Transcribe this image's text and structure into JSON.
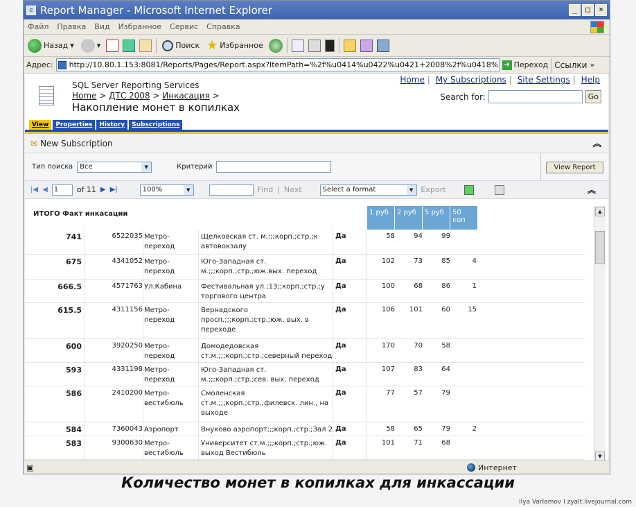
{
  "window": {
    "title": "Report Manager - Microsoft Internet Explorer"
  },
  "menu": [
    "Файл",
    "Правка",
    "Вид",
    "Избранное",
    "Сервис",
    "Справка"
  ],
  "toolbar": {
    "back": "Назад",
    "search": "Поиск",
    "favorites": "Избранное"
  },
  "address": {
    "label": "Адрес:",
    "url": "http://10.80.1.153:8081/Reports/Pages/Report.aspx?ItemPath=%2f%u0414%u0422%u0421+2008%2f%u0418%u043d%u",
    "go": "Переход",
    "links": "Ссылки"
  },
  "report_header": {
    "service": "SQL Server Reporting Services",
    "breadcrumb": [
      "Home",
      "ДТС 2008",
      "Инкасация"
    ],
    "title": "Накопление монет в копилках",
    "links": [
      "Home",
      "My Subscriptions",
      "Site Settings",
      "Help"
    ],
    "search_label": "Search for:",
    "go": "Go"
  },
  "tabs": [
    "View",
    "Properties",
    "History",
    "Subscriptions"
  ],
  "new_subscription": "New Subscription",
  "params": {
    "search_type_label": "Тип поиска",
    "search_type_value": "Все",
    "criteria_label": "Критерий",
    "view_report": "View Report"
  },
  "report_toolbar": {
    "page": "1",
    "of_pages": "of 11",
    "zoom": "100%",
    "find": "Find",
    "next": "Next",
    "format": "Select a format",
    "export": "Export"
  },
  "report": {
    "title": "ИТОГО Факт инкасации",
    "columns": [
      "1 руб",
      "2 руб",
      "5 руб",
      "50 коп"
    ],
    "rows": [
      {
        "total": "741",
        "id": "6522035",
        "type": "Метро-\nпереход",
        "address": "Щелковская ст. м.;;;корп.;стр.;к автовокзалу",
        "flag": "Да",
        "r1": "58",
        "r2": "94",
        "r5": "99",
        "k50": ""
      },
      {
        "total": "675",
        "id": "4341052",
        "type": "Метро-\nпереход",
        "address": "Юго-Западная ст. м.;;;корп.;стр.;юж.вых. переход",
        "flag": "Да",
        "r1": "102",
        "r2": "73",
        "r5": "85",
        "k50": "4"
      },
      {
        "total": "666.5",
        "id": "4571763",
        "type": "Ул.Кабина",
        "address": "Фестивальная ул.;13;;корп.;стр.;у торгового центра",
        "flag": "Да",
        "r1": "100",
        "r2": "68",
        "r5": "86",
        "k50": "1"
      },
      {
        "total": "615.5",
        "id": "4311156",
        "type": "Метро-\nпереход",
        "address": "Вернадского просп.;;;корп.;стр.;юж. вых. в переходе",
        "flag": "Да",
        "r1": "106",
        "r2": "101",
        "r5": "60",
        "k50": "15"
      },
      {
        "total": "600",
        "id": "3920250",
        "type": "Метро-\nпереход",
        "address": "Домодедовская ст.м.;;;корп.;стр.;северный переход",
        "flag": "Да",
        "r1": "170",
        "r2": "70",
        "r5": "58",
        "k50": ""
      },
      {
        "total": "593",
        "id": "4331198",
        "type": "Метро-\nпереход",
        "address": "Юго-Западная ст. м.;;;корп.;стр.;сев. вых. переход",
        "flag": "Да",
        "r1": "107",
        "r2": "83",
        "r5": "64",
        "k50": ""
      },
      {
        "total": "586",
        "id": "2410200",
        "type": "Метро-\nвестибюль",
        "address": "Смоленская ст.м.;;;корп.;стр.;филевск. лин., на выходе",
        "flag": "Да",
        "r1": "77",
        "r2": "57",
        "r5": "79",
        "k50": ""
      },
      {
        "total": "584",
        "id": "7360043",
        "type": "Аэропорт",
        "address": "Внуково аэропорт;;;корп.;стр.;Зал 2",
        "flag": "Да",
        "r1": "58",
        "r2": "65",
        "r5": "79",
        "k50": "2"
      },
      {
        "total": "583",
        "id": "9300630",
        "type": "Метро-\nвестибюль",
        "address": "Университет ст.м.;;;корп.;стр.;юж. выход Вестибюль",
        "flag": "Да",
        "r1": "101",
        "r2": "71",
        "r5": "68",
        "k50": ""
      }
    ]
  },
  "status": {
    "zone": "Интернет"
  },
  "caption": "Количество монет в копилках для инкассации",
  "credit": "Ilya Varlamov I zyalt.livejournal.com"
}
